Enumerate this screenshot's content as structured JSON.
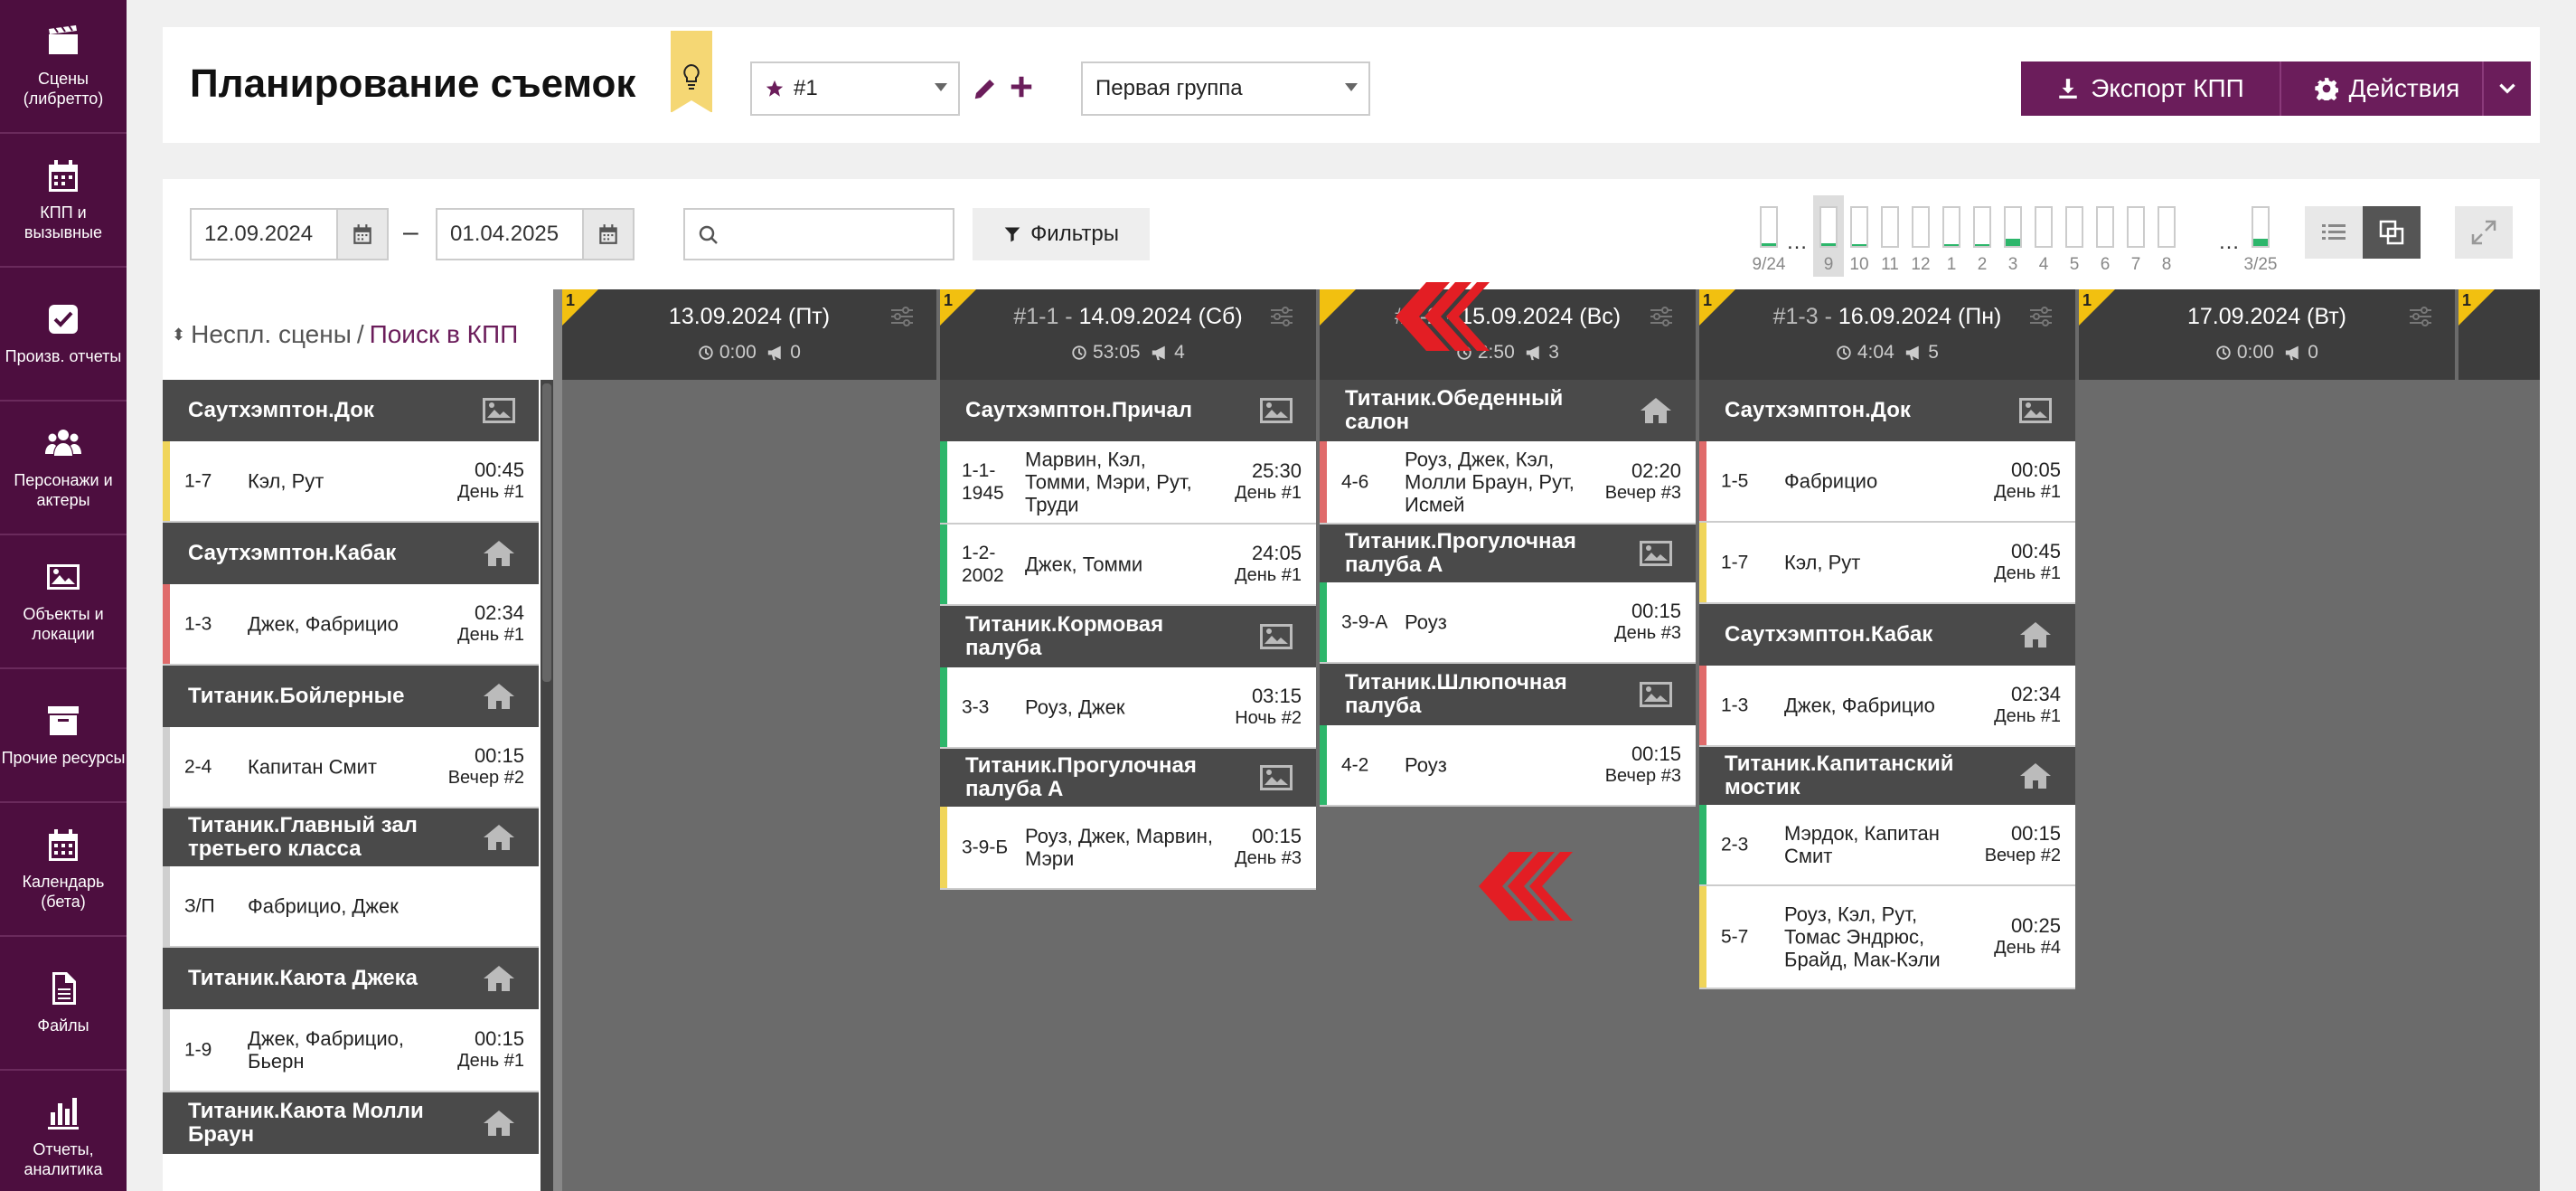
{
  "nav": [
    {
      "label": "Сцены (либретто)",
      "icon": "clapperboard-icon"
    },
    {
      "label": "КПП и вызывные",
      "icon": "calendar-icon"
    },
    {
      "label": "Произв. отчеты",
      "icon": "checkbox-icon"
    },
    {
      "label": "Персонажи и актеры",
      "icon": "people-icon"
    },
    {
      "label": "Объекты и локации",
      "icon": "picture-icon"
    },
    {
      "label": "Прочие ресурсы",
      "icon": "archive-box-icon"
    },
    {
      "label": "Календарь (бета)",
      "icon": "calendar-grid-icon"
    },
    {
      "label": "Файлы",
      "icon": "file-icon"
    },
    {
      "label": "Отчеты, аналитика",
      "icon": "bar-chart-icon"
    }
  ],
  "header": {
    "title": "Планирование съемок",
    "version": "#1",
    "group": "Первая группа",
    "export_label": "Экспорт КПП",
    "actions_label": "Действия"
  },
  "toolbar": {
    "date_from": "12.09.2024",
    "date_to": "01.04.2025",
    "dash": "–",
    "search_placeholder": "",
    "filters_label": "Фильтры",
    "ellipsis": "…"
  },
  "minibars": [
    {
      "label": "9/24",
      "fill": 0.08
    },
    {
      "label": "9",
      "fill": 0.08,
      "selected": true
    },
    {
      "label": "10",
      "fill": 0.05
    },
    {
      "label": "11",
      "fill": 0
    },
    {
      "label": "12",
      "fill": 0
    },
    {
      "label": "1",
      "fill": 0.05
    },
    {
      "label": "2",
      "fill": 0.05
    },
    {
      "label": "3",
      "fill": 0.18
    },
    {
      "label": "4",
      "fill": 0
    },
    {
      "label": "5",
      "fill": 0
    },
    {
      "label": "6",
      "fill": 0
    },
    {
      "label": "7",
      "fill": 0
    },
    {
      "label": "8",
      "fill": 0
    },
    {
      "label": "3/25",
      "fill": 0.18
    }
  ],
  "colors": {
    "sidebar": "#4d0e3f",
    "accent": "#6b1d5b",
    "board": "#6b6b6b",
    "stripe_green": "#2db66b",
    "stripe_yellow": "#f0d55a",
    "stripe_red": "#e06b6b",
    "stripe_gray": "#cfcfcf",
    "flag_yellow": "#f2c010",
    "arrow_red": "#e31e24"
  },
  "left": {
    "sort_icon": "⬍",
    "label1": "Неспл. сцены",
    "slash": "/",
    "label2": "Поиск в КПП",
    "groups": [
      {
        "name": "Саутхэмптон.Док",
        "icon": "image-icon",
        "scenes": [
          {
            "n": "1-7",
            "who": "Кэл, Рут",
            "dur": "00:45",
            "dn": "День #1",
            "c": "stripe_yellow"
          }
        ]
      },
      {
        "name": "Саутхэмптон.Кабак",
        "icon": "house-icon",
        "scenes": [
          {
            "n": "1-3",
            "who": "Джек, Фабрицио",
            "dur": "02:34",
            "dn": "День #1",
            "c": "stripe_red"
          }
        ]
      },
      {
        "name": "Титаник.Бойлерные",
        "icon": "house-icon",
        "scenes": [
          {
            "n": "2-4",
            "who": "Капитан Смит",
            "dur": "00:15",
            "dn": "Вечер #2",
            "c": "stripe_gray"
          }
        ]
      },
      {
        "name": "Титаник.Главный зал третьего класса",
        "icon": "house-icon",
        "scenes": [
          {
            "n": "З/П",
            "who": "Фабрицио, Джек",
            "dur": "",
            "dn": "",
            "c": "stripe_gray"
          }
        ]
      },
      {
        "name": "Титаник.Каюта Джека",
        "icon": "house-icon",
        "scenes": [
          {
            "n": "1-9",
            "who": "Джек, Фабрицио, Бьерн",
            "dur": "00:15",
            "dn": "День #1",
            "c": "stripe_gray"
          }
        ]
      },
      {
        "name": "Титаник.Каюта Молли Браун",
        "icon": "house-icon",
        "scenes": []
      }
    ]
  },
  "days": [
    {
      "num": "",
      "date": "13.09.2024 (Пт)",
      "time": "0:00",
      "count": "0",
      "flag": "1",
      "groups": []
    },
    {
      "num": "#1-1 - ",
      "date": "14.09.2024 (Сб)",
      "time": "53:05",
      "count": "4",
      "flag": "1",
      "groups": [
        {
          "name": "Саутхэмптон.Причал",
          "icon": "image-icon",
          "scenes": [
            {
              "n": "1-1-1945",
              "who": "Марвин, Кэл, Томми, Мэри, Рут, Труди",
              "dur": "25:30",
              "dn": "День #1",
              "c": "stripe_green"
            },
            {
              "n": "1-2-2002",
              "who": "Джек, Томми",
              "dur": "24:05",
              "dn": "День #1",
              "c": "stripe_green"
            }
          ]
        },
        {
          "name": "Титаник.Кормовая палуба",
          "icon": "image-icon",
          "scenes": [
            {
              "n": "3-3",
              "who": "Роуз, Джек",
              "dur": "03:15",
              "dn": "Ночь #2",
              "c": "stripe_green"
            }
          ]
        },
        {
          "name": "Титаник.Прогулочная палуба А",
          "icon": "image-icon",
          "scenes": [
            {
              "n": "3-9-Б",
              "who": "Роуз, Джек, Марвин, Мэри",
              "dur": "00:15",
              "dn": "День #3",
              "c": "stripe_yellow"
            }
          ]
        }
      ]
    },
    {
      "num": "#1-2 - ",
      "date": "15.09.2024 (Вс)",
      "time": "2:50",
      "count": "3",
      "flag": "",
      "groups": [
        {
          "name": "Титаник.Обеденный салон",
          "icon": "house-icon",
          "scenes": [
            {
              "n": "4-6",
              "who": "Роуз, Джек, Кэл, Молли Браун, Рут, Исмей",
              "dur": "02:20",
              "dn": "Вечер #3",
              "c": "stripe_red"
            }
          ]
        },
        {
          "name": "Титаник.Прогулочная палуба А",
          "icon": "image-icon",
          "scenes": [
            {
              "n": "3-9-А",
              "who": "Роуз",
              "dur": "00:15",
              "dn": "День #3",
              "c": "stripe_green"
            }
          ]
        },
        {
          "name": "Титаник.Шлюпочная палуба",
          "icon": "image-icon",
          "scenes": [
            {
              "n": "4-2",
              "who": "Роуз",
              "dur": "00:15",
              "dn": "Вечер #3",
              "c": "stripe_green"
            }
          ]
        }
      ]
    },
    {
      "num": "#1-3 - ",
      "date": "16.09.2024 (Пн)",
      "time": "4:04",
      "count": "5",
      "flag": "1",
      "groups": [
        {
          "name": "Саутхэмптон.Док",
          "icon": "image-icon",
          "scenes": [
            {
              "n": "1-5",
              "who": "Фабрицио",
              "dur": "00:05",
              "dn": "День #1",
              "c": "stripe_red"
            },
            {
              "n": "1-7",
              "who": "Кэл, Рут",
              "dur": "00:45",
              "dn": "День #1",
              "c": "stripe_yellow"
            }
          ]
        },
        {
          "name": "Саутхэмптон.Кабак",
          "icon": "house-icon",
          "scenes": [
            {
              "n": "1-3",
              "who": "Джек, Фабрицио",
              "dur": "02:34",
              "dn": "День #1",
              "c": "stripe_red"
            }
          ]
        },
        {
          "name": "Титаник.Капитанский мостик",
          "icon": "house-icon",
          "scenes": [
            {
              "n": "2-3",
              "who": "Мэрдок, Капитан Смит",
              "dur": "00:15",
              "dn": "Вечер #2",
              "c": "stripe_green"
            },
            {
              "n": "5-7",
              "who": "Роуз, Кэл, Рут, Томас Эндрюс, Брайд, Мак-Кэли",
              "dur": "00:25",
              "dn": "День #4",
              "c": "stripe_yellow"
            }
          ]
        }
      ]
    },
    {
      "num": "",
      "date": "17.09.2024 (Вт)",
      "time": "0:00",
      "count": "0",
      "flag": "1",
      "groups": []
    },
    {
      "num": "",
      "date": "",
      "time": "",
      "count": "",
      "flag": "1",
      "groups": []
    }
  ]
}
